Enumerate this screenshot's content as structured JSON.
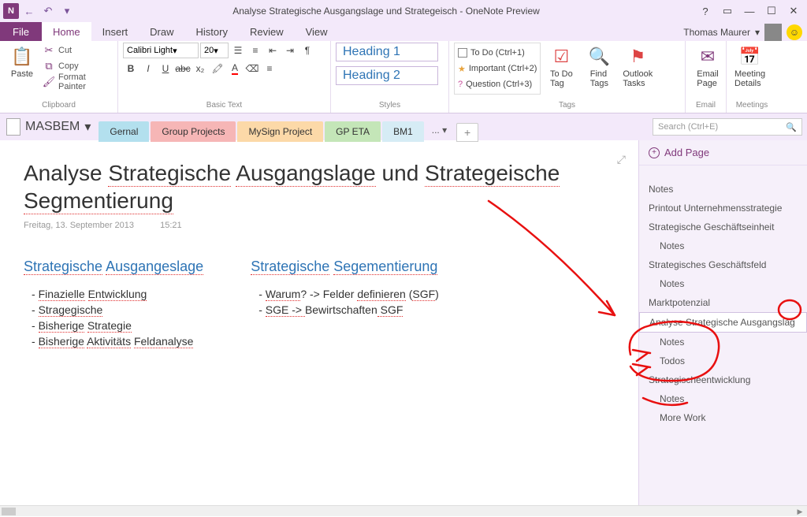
{
  "window": {
    "title": "Analyse Strategische Ausgangslage und Strategeisch - OneNote Preview",
    "user": "Thomas Maurer"
  },
  "ribbon_tabs": {
    "file": "File",
    "home": "Home",
    "insert": "Insert",
    "draw": "Draw",
    "history": "History",
    "review": "Review",
    "view": "View"
  },
  "clipboard": {
    "paste": "Paste",
    "cut": "Cut",
    "copy": "Copy",
    "format_painter": "Format Painter",
    "label": "Clipboard"
  },
  "basic_text": {
    "font": "Calibri Light",
    "size": "20",
    "label": "Basic Text"
  },
  "styles": {
    "h1": "Heading 1",
    "h2": "Heading 2",
    "label": "Styles"
  },
  "tags": {
    "todo": "To Do (Ctrl+1)",
    "important": "Important (Ctrl+2)",
    "question": "Question (Ctrl+3)",
    "todo_tag": "To Do\nTag",
    "find_tags": "Find\nTags",
    "outlook_tasks": "Outlook\nTasks",
    "label": "Tags"
  },
  "email": {
    "btn": "Email\nPage",
    "label": "Email"
  },
  "meetings": {
    "btn": "Meeting\nDetails",
    "label": "Meetings"
  },
  "notebook": {
    "name": "MASBEM",
    "sections": [
      "Gernal",
      "Group Projects",
      "MySign Project",
      "GP ETA",
      "BM1"
    ],
    "more": "...",
    "search_placeholder": "Search (Ctrl+E)"
  },
  "page": {
    "title_parts": [
      "Analyse ",
      "Strategische",
      " ",
      "Ausgangslage",
      " und ",
      "Strategeische",
      " ",
      "Segmentierung"
    ],
    "date": "Freitag, 13. September 2013",
    "time": "15:21",
    "col1": {
      "heading_parts": [
        "Strategische",
        " ",
        "Ausgangeslage"
      ],
      "items": [
        [
          "Finazielle",
          " ",
          "Entwicklung"
        ],
        [
          "Stragegische"
        ],
        [
          "Bisherige",
          " ",
          "Strategie"
        ],
        [
          "Bisherige",
          " ",
          "Aktivitäts",
          " ",
          "Feldanalyse"
        ]
      ]
    },
    "col2": {
      "heading_parts": [
        "Strategische",
        " ",
        "Segementierung"
      ],
      "items": [
        [
          "Warum",
          "? -> Felder ",
          "definieren",
          " (",
          "SGF",
          ")"
        ],
        [
          "SGE -> ",
          "Bewirtschaften",
          " SGF"
        ]
      ]
    }
  },
  "page_list": {
    "add": "Add Page",
    "items": [
      {
        "label": "Notes",
        "sub": false
      },
      {
        "label": "Printout Unternehmensstrategie",
        "sub": false
      },
      {
        "label": "Strategische Geschäftseinheit",
        "sub": false
      },
      {
        "label": "Notes",
        "sub": true
      },
      {
        "label": "Strategisches Geschäftsfeld",
        "sub": false
      },
      {
        "label": "Notes",
        "sub": true
      },
      {
        "label": "Marktpotenzial",
        "sub": false,
        "chev": true
      },
      {
        "label": "Analyse Strategische Ausgangslag",
        "sub": false,
        "active": true
      },
      {
        "label": "Notes",
        "sub": true
      },
      {
        "label": "Todos",
        "sub": true
      },
      {
        "label": "Strategischeentwicklung",
        "sub": false
      },
      {
        "label": "Notes",
        "sub": true
      },
      {
        "label": "More Work",
        "sub": true
      }
    ]
  }
}
